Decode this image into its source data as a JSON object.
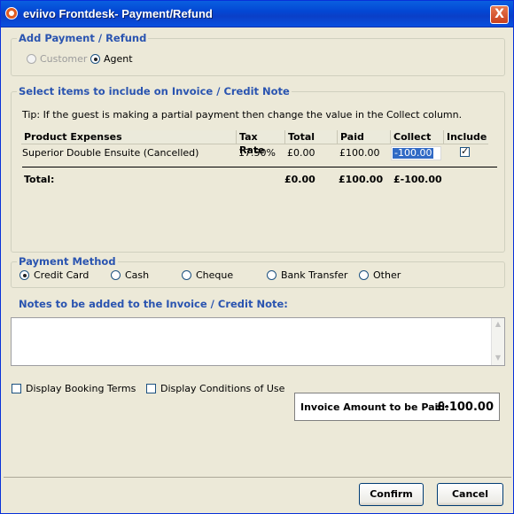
{
  "window": {
    "title": "eviivo Frontdesk- Payment/Refund",
    "close_label": "X"
  },
  "payment_refund": {
    "legend": "Add Payment / Refund",
    "options": [
      {
        "label": "Customer",
        "selected": false,
        "enabled": false
      },
      {
        "label": "Agent",
        "selected": true,
        "enabled": true
      }
    ]
  },
  "items": {
    "legend": "Select items to include on Invoice / Credit Note",
    "tip": "Tip: If the guest is making a partial payment then change the value in the Collect column.",
    "columns": [
      "Product Expenses",
      "Tax Rate",
      "Total",
      "Paid",
      "Collect",
      "Include"
    ],
    "rows": [
      {
        "product": "Superior Double Ensuite (Cancelled)",
        "tax_rate": "17.50%",
        "total": "£0.00",
        "paid": "£100.00",
        "collect": "-100.00",
        "include": true
      }
    ],
    "totals": {
      "label": "Total:",
      "total": "£0.00",
      "paid": "£100.00",
      "collect": "£-100.00"
    }
  },
  "payment_method": {
    "legend": "Payment Method",
    "options": [
      {
        "label": "Credit Card",
        "selected": true
      },
      {
        "label": "Cash",
        "selected": false
      },
      {
        "label": "Cheque",
        "selected": false
      },
      {
        "label": "Bank Transfer",
        "selected": false
      },
      {
        "label": "Other",
        "selected": false
      }
    ]
  },
  "notes": {
    "label": "Notes to be added to the Invoice / Credit Note:",
    "value": ""
  },
  "options": {
    "display_booking_terms": {
      "label": "Display Booking Terms",
      "checked": false
    },
    "display_conditions": {
      "label": "Display Conditions of Use",
      "checked": false
    }
  },
  "invoice_amount": {
    "label": "Invoice Amount to be Paid:",
    "value": "£-100.00"
  },
  "buttons": {
    "confirm": "Confirm",
    "cancel": "Cancel"
  },
  "colors": {
    "title_bar": "#0a4fd8",
    "legend_text": "#2a54b0",
    "selection": "#316ac5",
    "background": "#ece9d8"
  }
}
